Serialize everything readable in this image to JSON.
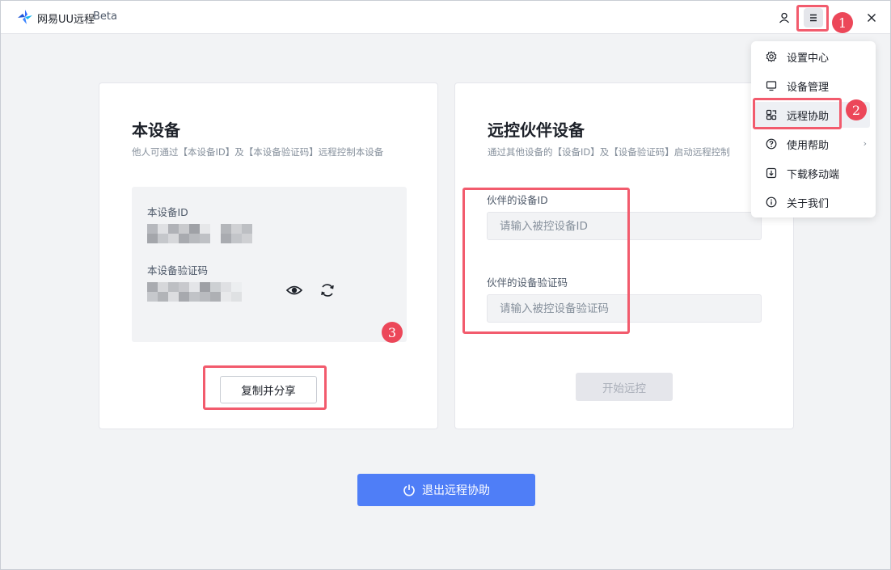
{
  "app": {
    "title": "网易UU远程",
    "beta": "Beta"
  },
  "local_device": {
    "title": "本设备",
    "description": "他人可通过【本设备ID】及【本设备验证码】远程控制本设备",
    "id_label": "本设备ID",
    "code_label": "本设备验证码",
    "copy_button": "复制并分享"
  },
  "partner_device": {
    "title": "远控伙伴设备",
    "description": "通过其他设备的【设备ID】及【设备验证码】启动远程控制",
    "id_label": "伙伴的设备ID",
    "id_placeholder": "请输入被控设备ID",
    "code_label": "伙伴的设备验证码",
    "code_placeholder": "请输入被控设备验证码",
    "start_button": "开始远控"
  },
  "exit_button": "退出远程协助",
  "menu": {
    "items": [
      {
        "label": "设置中心",
        "icon": "gear-icon"
      },
      {
        "label": "设备管理",
        "icon": "monitor-icon"
      },
      {
        "label": "远程协助",
        "icon": "remote-assist-icon"
      },
      {
        "label": "使用帮助",
        "icon": "help-icon"
      },
      {
        "label": "下载移动端",
        "icon": "download-icon"
      },
      {
        "label": "关于我们",
        "icon": "info-icon"
      }
    ],
    "help_chevron": "›"
  },
  "annotations": [
    "1",
    "2",
    "3"
  ],
  "colors": {
    "accent": "#4f7ef7",
    "highlight": "#f25b6d",
    "badge": "#ec4759"
  }
}
